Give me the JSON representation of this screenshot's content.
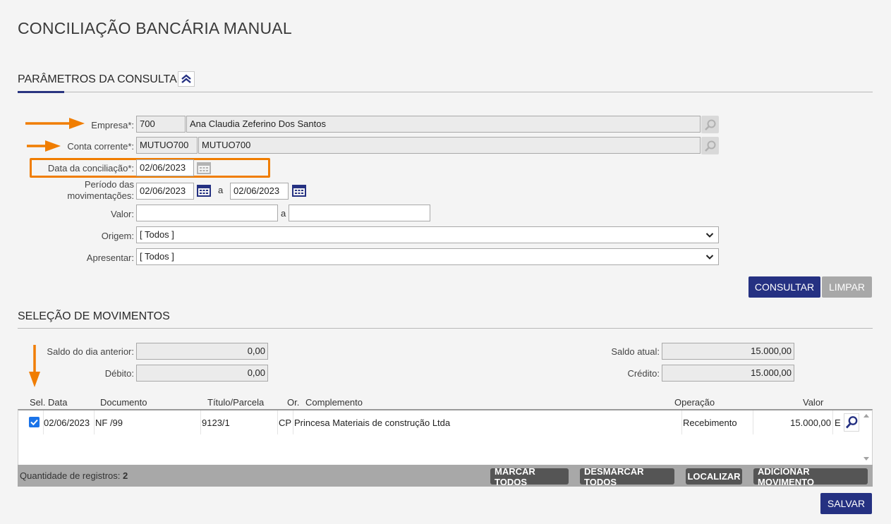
{
  "page": {
    "title": "CONCILIAÇÃO BANCÁRIA MANUAL"
  },
  "params": {
    "section_title": "PARÂMETROS DA CONSULTA",
    "empresa": {
      "label": "Empresa*:",
      "code": "700",
      "name": "Ana Claudia Zeferino Dos Santos"
    },
    "conta": {
      "label": "Conta corrente*:",
      "code": "MUTUO700",
      "name": "MUTUO700"
    },
    "data_conciliacao": {
      "label": "Data da conciliação*:",
      "value": "02/06/2023"
    },
    "periodo": {
      "label_line1": "Período das",
      "label_line2": "movimentações:",
      "from": "02/06/2023",
      "sep": "a",
      "to": "02/06/2023"
    },
    "valor": {
      "label": "Valor:",
      "from": "",
      "sep": "a",
      "to": ""
    },
    "origem": {
      "label": "Origem:",
      "selected": "[ Todos ]"
    },
    "apresentar": {
      "label": "Apresentar:",
      "selected": "[ Todos ]"
    },
    "consultar_label": "CONSULTAR",
    "limpar_label": "LIMPAR"
  },
  "movimentos": {
    "section_title": "SELEÇÃO DE MOVIMENTOS",
    "saldo_anterior": {
      "label": "Saldo do dia anterior:",
      "value": "0,00"
    },
    "debito": {
      "label": "Débito:",
      "value": "0,00"
    },
    "saldo_atual": {
      "label": "Saldo atual:",
      "value": "15.000,00"
    },
    "credito": {
      "label": "Crédito:",
      "value": "15.000,00"
    },
    "columns": {
      "sel": "Sel.",
      "data": "Data",
      "documento": "Documento",
      "titulo": "Título/Parcela",
      "origem": "Or.",
      "complemento": "Complemento",
      "operacao": "Operação",
      "valor": "Valor"
    },
    "rows": [
      {
        "checked": true,
        "data": "02/06/2023",
        "documento": "NF /99",
        "titulo": "9123/1",
        "origem": "CP",
        "complemento": "Princesa Materiais de construção Ltda",
        "operacao": "Recebimento",
        "valor": "15.000,00",
        "tipo": "E"
      }
    ],
    "quantidade_label": "Quantidade de registros:",
    "quantidade_value": "2",
    "marcar_todos": "MARCAR TODOS",
    "desmarcar_todos": "DESMARCAR TODOS",
    "localizar": "LOCALIZAR",
    "adicionar": "ADICIONAR MOVIMENTO",
    "salvar": "SALVAR"
  },
  "colors": {
    "accent": "#253182",
    "annotation": "#f07d00",
    "disabled": "#a8a8a8"
  }
}
